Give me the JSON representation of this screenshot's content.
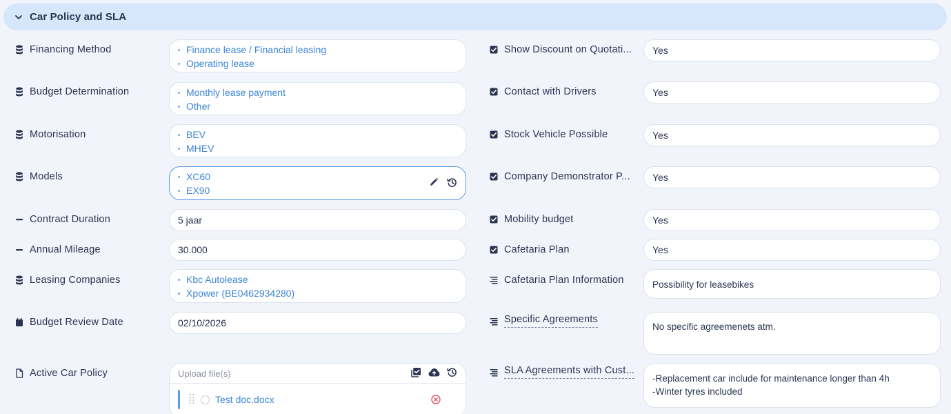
{
  "section": {
    "title": "Car Policy and SLA"
  },
  "left": [
    {
      "label": "Financing Method",
      "icon": "database-icon",
      "items": [
        "Finance lease / Financial leasing",
        "Operating lease"
      ]
    },
    {
      "label": "Budget Determination",
      "icon": "database-icon",
      "items": [
        "Monthly lease payment",
        "Other"
      ]
    },
    {
      "label": "Motorisation",
      "icon": "database-icon",
      "items": [
        "BEV",
        "MHEV"
      ]
    },
    {
      "label": "Models",
      "icon": "database-icon",
      "items": [
        "XC60",
        "EX90"
      ]
    },
    {
      "label": "Contract Duration",
      "icon": "minus-icon",
      "value": "5 jaar"
    },
    {
      "label": "Annual Mileage",
      "icon": "minus-icon",
      "value": "30.000"
    },
    {
      "label": "Leasing Companies",
      "icon": "database-icon",
      "items": [
        "Kbc Autolease",
        "Xpower (BE0462934280)"
      ]
    },
    {
      "label": "Budget Review Date",
      "icon": "calendar-icon",
      "value": "02/10/2026"
    },
    {
      "label": "Active Car Policy",
      "icon": "file-icon",
      "placeholder": "Upload file(s)",
      "file": "Test doc.docx"
    }
  ],
  "right": [
    {
      "label": "Show Discount on Quotati...",
      "icon": "checkbox-icon",
      "value": "Yes"
    },
    {
      "label": "Contact with Drivers",
      "icon": "checkbox-icon",
      "value": "Yes"
    },
    {
      "label": "Stock Vehicle Possible",
      "icon": "checkbox-icon",
      "value": "Yes"
    },
    {
      "label": "Company Demonstrator P...",
      "icon": "checkbox-icon",
      "value": "Yes"
    },
    {
      "label": "Mobility budget",
      "icon": "checkbox-icon",
      "value": "Yes"
    },
    {
      "label": "Cafetaria Plan",
      "icon": "checkbox-icon",
      "value": "Yes"
    },
    {
      "label": "Cafetaria Plan Information",
      "icon": "text-lines-icon",
      "value": "Possibility for leasebikes"
    },
    {
      "label": "Specific Agreements",
      "icon": "text-lines-icon",
      "value": "No specific agreemenets atm."
    },
    {
      "label": "SLA Agreements with Cust...",
      "icon": "text-lines-icon",
      "lines": [
        "-Replacement car include for maintenance longer than 4h",
        "-Winter tyres included"
      ]
    }
  ]
}
